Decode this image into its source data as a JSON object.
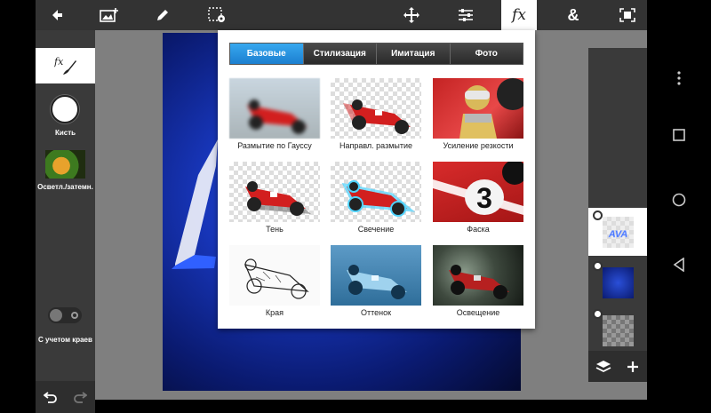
{
  "toolbar": {
    "back_icon": "arrow-left-icon",
    "add_image_icon": "add-image-icon",
    "pencil_icon": "pencil-icon",
    "selection_icon": "selection-settings-icon",
    "transform_icon": "move-arrows-icon",
    "adjust_icon": "sliders-icon",
    "fx_label": "fx",
    "blend_label": "&",
    "fit_icon": "fit-screen-icon"
  },
  "left_panel": {
    "fx_icon": "fx-brush-icon",
    "brush_label": "Кисть",
    "dodge_label": "Осветл./затемн.",
    "edge_aware_label": "С учетом краев",
    "undo_icon": "undo-icon",
    "redo_icon": "redo-icon"
  },
  "fx_popup": {
    "tabs": [
      {
        "label": "Базовые",
        "active": true
      },
      {
        "label": "Стилизация",
        "active": false
      },
      {
        "label": "Имитация",
        "active": false
      },
      {
        "label": "Фото",
        "active": false
      }
    ],
    "effects": [
      {
        "label": "Размытие по Гауссу"
      },
      {
        "label": "Направл. размытие"
      },
      {
        "label": "Усиление резкости"
      },
      {
        "label": "Тень"
      },
      {
        "label": "Свечение"
      },
      {
        "label": "Фаска"
      },
      {
        "label": "Края"
      },
      {
        "label": "Оттенок"
      },
      {
        "label": "Освещение"
      }
    ]
  },
  "layers_panel": {
    "layers_icon": "layers-icon",
    "add_icon": "plus-icon"
  },
  "nav": {
    "menu_icon": "more-vert-icon",
    "recents_icon": "recents-square-icon",
    "home_icon": "home-circle-icon",
    "back_icon": "back-triangle-icon"
  }
}
